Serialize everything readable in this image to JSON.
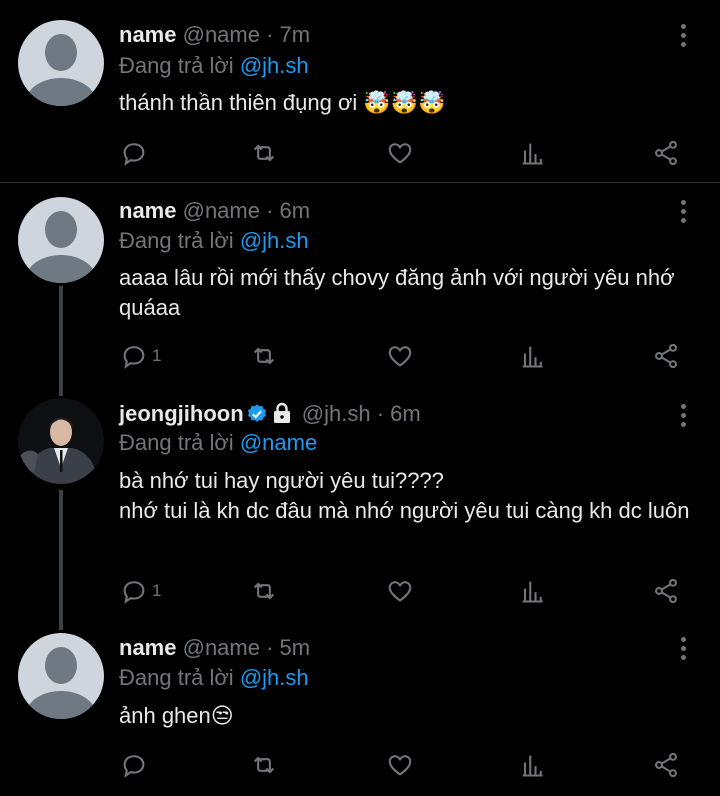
{
  "tweets": [
    {
      "name": "name",
      "handle": "@name",
      "time": "· 7m",
      "reply_prefix": "Đang trả lời",
      "reply_to": "@jh.sh",
      "text": "thánh thần thiên đụng ơi 🤯🤯🤯",
      "reply_count": ""
    },
    {
      "name": "name",
      "handle": "@name",
      "time": "· 6m",
      "reply_prefix": "Đang trả lời",
      "reply_to": "@jh.sh",
      "text": "aaaa lâu rồi mới thấy chovy đăng ảnh với người yêu nhớ quáaa",
      "reply_count": "1"
    },
    {
      "name": "jeongjihoon",
      "handle": "@jh.sh",
      "time": "· 6m",
      "reply_prefix": "Đang trả lời",
      "reply_to": "@name",
      "text_lines": [
        "bà nhớ tui hay người yêu tui????",
        "nhớ tui là kh dc đâu mà nhớ người yêu tui càng kh dc luôn"
      ],
      "reply_count": "1",
      "verified": true,
      "protected": true
    },
    {
      "name": "name",
      "handle": "@name",
      "time": "· 5m",
      "reply_prefix": "Đang trả lời",
      "reply_to": "@jh.sh",
      "text": "ảnh ghen😒",
      "reply_count": ""
    }
  ],
  "icons": {
    "reply": "reply-icon",
    "retweet": "retweet-icon",
    "like": "heart-icon",
    "analytics": "analytics-icon",
    "share": "share-icon",
    "more": "more-icon"
  },
  "colors": {
    "background": "#000000",
    "text": "#e7e9ea",
    "muted": "#71767b",
    "accent": "#1d9bf0",
    "separator": "#2f3336"
  }
}
